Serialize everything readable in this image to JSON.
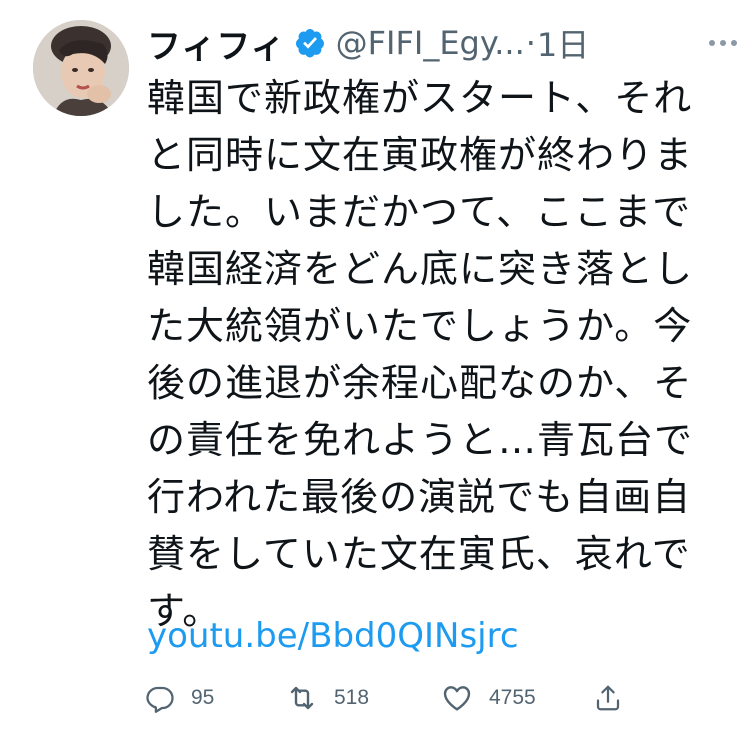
{
  "user": {
    "display_name": "フィフィ",
    "handle": "@FIFI_Egy...",
    "separator": "·",
    "time": "1日",
    "verified": true,
    "avatar_icon": "avatar-photo"
  },
  "tweet": {
    "lines": [
      "韓国で新政権がスタート、それ",
      "と同時に文在寅政権が終わりま",
      "した。いまだかつて、ここまで",
      "韓国経済をどん底に突き落とし",
      "た大統領がいたでしょうか。今",
      "後の進退が余程心配なのか、そ",
      "の責任を免れようと…青瓦台で",
      "行われた最後の演説でも自画自",
      "賛をしていた文在寅氏、哀れで",
      "す。"
    ],
    "link": "youtu.be/Bbd0QINsjrc"
  },
  "actions": {
    "reply": {
      "icon": "reply-icon",
      "count": "95"
    },
    "retweet": {
      "icon": "retweet-icon",
      "count": "518"
    },
    "like": {
      "icon": "heart-icon",
      "count": "4755"
    },
    "share": {
      "icon": "share-icon"
    }
  },
  "colors": {
    "text": "#0f1419",
    "secondary": "#536471",
    "link": "#1d9bf0",
    "verified": "#1d9bf0"
  }
}
